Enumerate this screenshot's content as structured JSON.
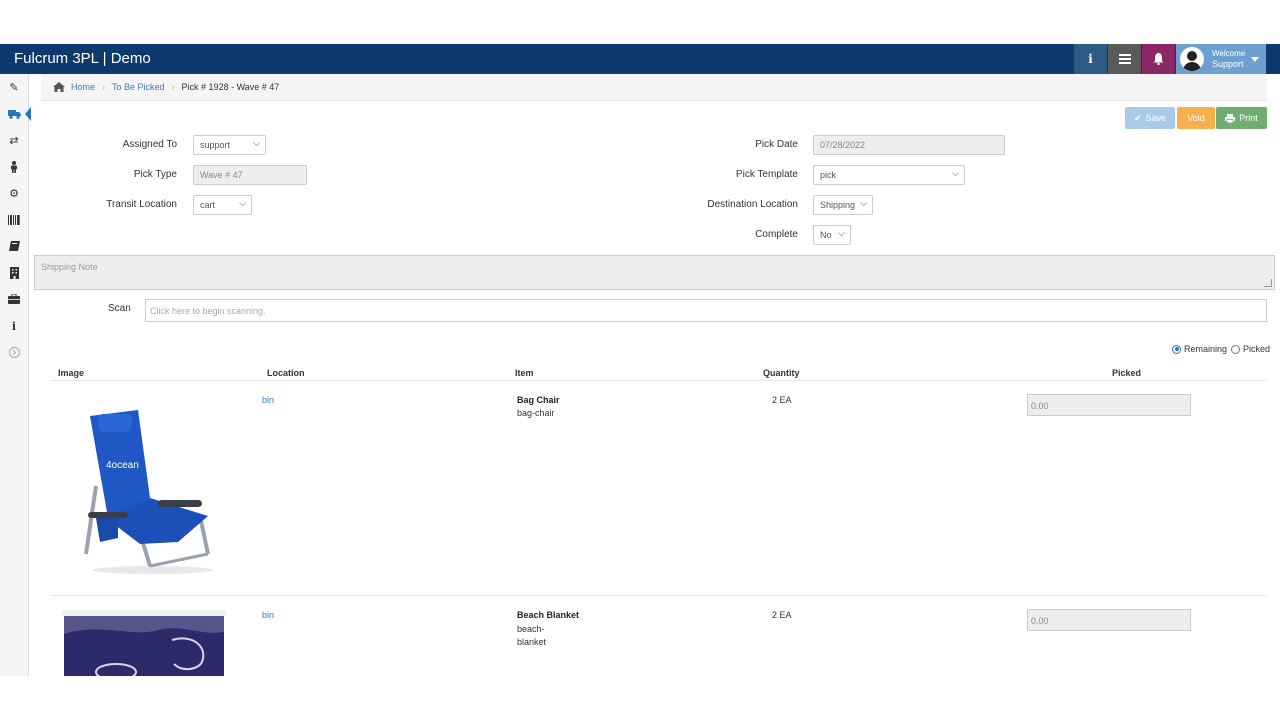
{
  "app": {
    "title": "Fulcrum 3PL | Demo"
  },
  "user": {
    "welcome": "Welcome",
    "name": "Support"
  },
  "sidebar": {
    "icons": [
      "pencil-icon",
      "truck-icon",
      "transfer-icon",
      "person-icon",
      "gear-icon",
      "barcode-icon",
      "book-icon",
      "building-icon",
      "briefcase-icon",
      "info-icon",
      "expand-icon"
    ]
  },
  "breadcrumb": {
    "home": "Home",
    "parent": "To Be Picked",
    "current": "Pick # 1928 - Wave # 47"
  },
  "actions": {
    "save": "Save",
    "void": "Void",
    "print": "Print"
  },
  "form": {
    "assigned_to_label": "Assigned To",
    "assigned_to": "support",
    "pick_type_label": "Pick Type",
    "pick_type": "Wave # 47",
    "transit_location_label": "Transit Location",
    "transit_location": "cart",
    "pick_date_label": "Pick Date",
    "pick_date": "07/28/2022",
    "pick_template_label": "Pick Template",
    "pick_template": "pick",
    "destination_location_label": "Destination Location",
    "destination_location": "Shipping",
    "complete_label": "Complete",
    "complete": "No",
    "shipping_note_placeholder": "Shipping Note",
    "scan_label": "Scan",
    "scan_placeholder": "Click here to begin scanning."
  },
  "filter": {
    "remaining": "Remaining",
    "picked": "Picked",
    "selected": "Remaining"
  },
  "table": {
    "headers": {
      "image": "Image",
      "location": "Location",
      "item": "Item",
      "quantity": "Quantity",
      "picked": "Picked"
    },
    "rows": [
      {
        "location": "bin",
        "item_name": "Bag Chair",
        "item_sku": "bag-chair",
        "quantity": "2 EA",
        "picked": "0.00",
        "image_text": "4ocean"
      },
      {
        "location": "bin",
        "item_name": "Beach Blanket",
        "item_sku": "beach-blanket",
        "quantity": "2 EA",
        "picked": "0.00"
      }
    ]
  },
  "colors": {
    "topbar": "#0d3a6e",
    "link": "#3a7bbd",
    "save": "#a9cbe9",
    "void": "#f5b04b",
    "print": "#6fae70",
    "bell": "#8b2667"
  }
}
